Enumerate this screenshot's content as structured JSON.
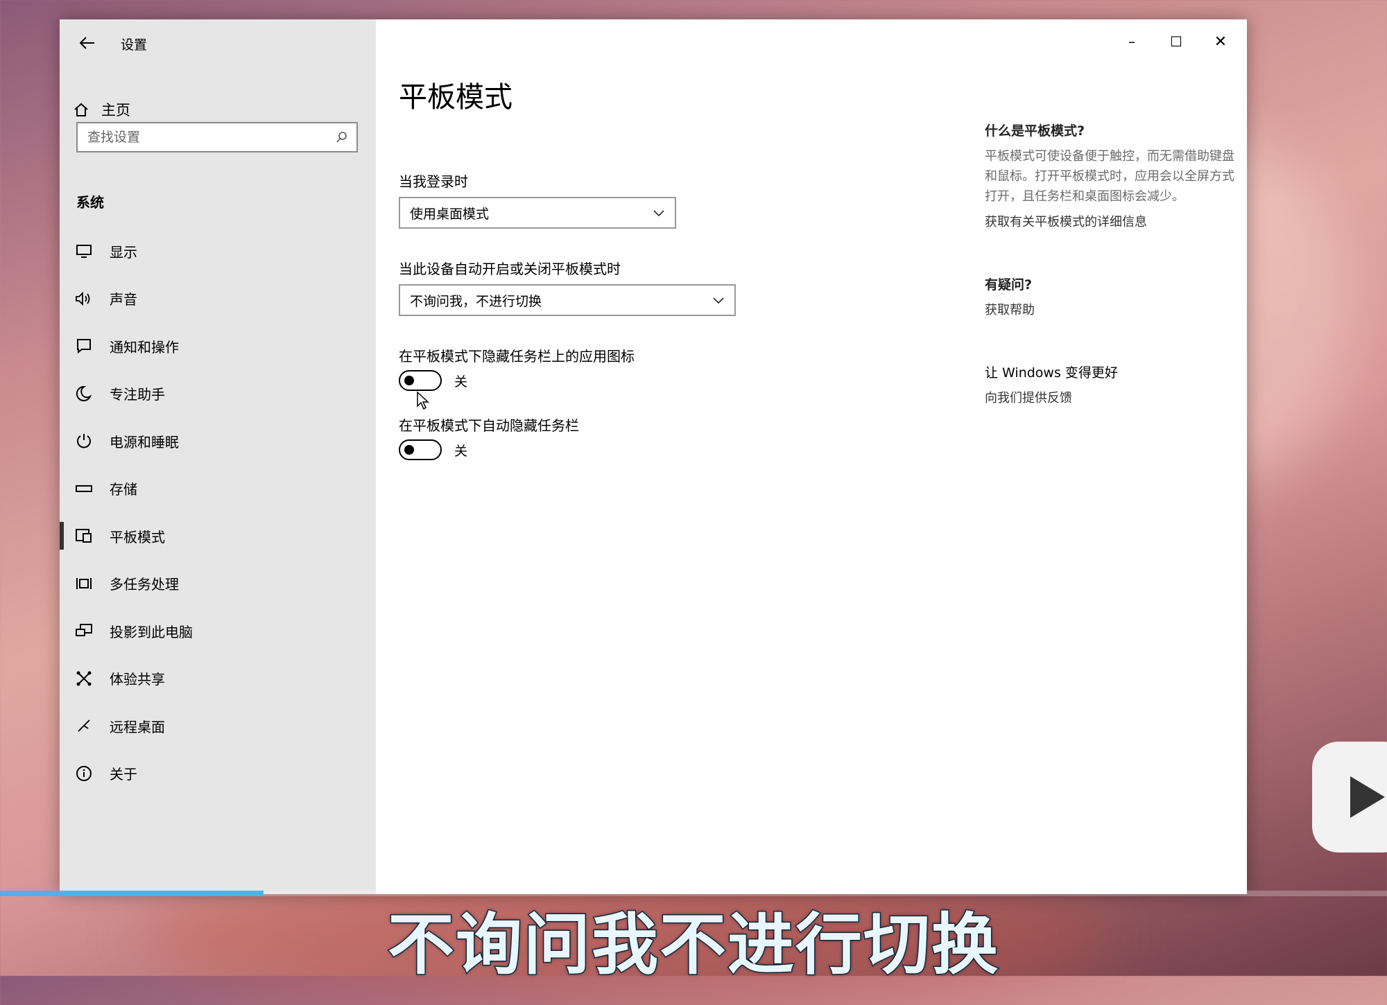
{
  "window": {
    "title": "设置",
    "controls": {
      "minimize": "–",
      "maximize": "☐",
      "close": "✕"
    }
  },
  "sidebar": {
    "home_label": "主页",
    "search_placeholder": "查找设置",
    "section_title": "系统",
    "items": [
      {
        "label": "显示",
        "icon": "monitor-icon"
      },
      {
        "label": "声音",
        "icon": "speaker-icon"
      },
      {
        "label": "通知和操作",
        "icon": "notification-icon"
      },
      {
        "label": "专注助手",
        "icon": "moon-icon"
      },
      {
        "label": "电源和睡眠",
        "icon": "power-icon"
      },
      {
        "label": "存储",
        "icon": "storage-icon"
      },
      {
        "label": "平板模式",
        "icon": "tablet-mode-icon",
        "active": true
      },
      {
        "label": "多任务处理",
        "icon": "multitask-icon"
      },
      {
        "label": "投影到此电脑",
        "icon": "project-icon"
      },
      {
        "label": "体验共享",
        "icon": "share-icon"
      },
      {
        "label": "远程桌面",
        "icon": "remote-desktop-icon"
      },
      {
        "label": "关于",
        "icon": "info-icon"
      }
    ]
  },
  "main": {
    "title": "平板模式",
    "login_label": "当我登录时",
    "login_value": "使用桌面模式",
    "auto_label": "当此设备自动开启或关闭平板模式时",
    "auto_value": "不询问我，不进行切换",
    "hide_icons_label": "在平板模式下隐藏任务栏上的应用图标",
    "hide_icons_state": "关",
    "auto_hide_label": "在平板模式下自动隐藏任务栏",
    "auto_hide_state": "关"
  },
  "side": {
    "what_title": "什么是平板模式?",
    "what_body": "平板模式可使设备便于触控，而无需借助键盘和鼠标。打开平板模式时，应用会以全屏方式打开，且任务栏和桌面图标会减少。",
    "what_link": "获取有关平板模式的详细信息",
    "question_title": "有疑问?",
    "question_link": "获取帮助",
    "improve_title": "让 Windows 变得更好",
    "improve_link": "向我们提供反馈"
  },
  "video": {
    "caption": "不询问我不进行切换",
    "progress_fraction": 0.19
  }
}
